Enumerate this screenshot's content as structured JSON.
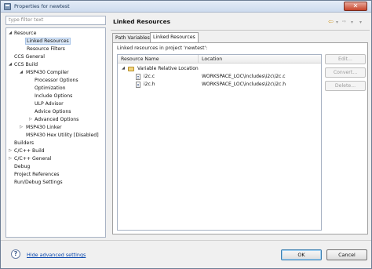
{
  "window": {
    "title": "Properties for newtest",
    "close_glyph": "✕"
  },
  "filter": {
    "placeholder": "type filter text"
  },
  "tree": [
    {
      "label": "Resource",
      "expanded": true
    },
    {
      "label": "Linked Resources",
      "selected": true
    },
    {
      "label": "Resource Filters"
    },
    {
      "label": "CCS General"
    },
    {
      "label": "CCS Build",
      "expanded": true
    },
    {
      "label": "MSP430 Compiler",
      "expanded": true
    },
    {
      "label": "Processor Options"
    },
    {
      "label": "Optimization"
    },
    {
      "label": "Include Options"
    },
    {
      "label": "ULP Advisor"
    },
    {
      "label": "Advice Options"
    },
    {
      "label": "Advanced Options",
      "collapsed": true
    },
    {
      "label": "MSP430 Linker",
      "collapsed": true
    },
    {
      "label": "MSP430 Hex Utility  [Disabled]"
    },
    {
      "label": "Builders"
    },
    {
      "label": "C/C++ Build",
      "collapsed": true
    },
    {
      "label": "C/C++ General",
      "collapsed": true
    },
    {
      "label": "Debug"
    },
    {
      "label": "Project References"
    },
    {
      "label": "Run/Debug Settings"
    }
  ],
  "page": {
    "title": "Linked Resources",
    "nav": {
      "back_icon": "back-arrow-icon",
      "forward_icon": "forward-arrow-icon",
      "menu_icon": "menu-down-icon"
    }
  },
  "tabs": [
    {
      "label": "Path Variables"
    },
    {
      "label": "Linked Resources",
      "active": true
    }
  ],
  "resources": {
    "caption": "Linked resources in project 'newtest':",
    "columns": [
      "Resource Name",
      "Location"
    ],
    "group": "Variable Relative Location",
    "rows": [
      {
        "name": "i2c.c",
        "location": "WORKSPACE_LOC\\includes\\i2c\\i2c.c"
      },
      {
        "name": "i2c.h",
        "location": "WORKSPACE_LOC\\includes\\i2c\\i2c.h"
      }
    ]
  },
  "side_buttons": {
    "edit": "Edit...",
    "convert": "Convert...",
    "delete": "Delete..."
  },
  "footer": {
    "help": "?",
    "advanced_link": "Hide advanced settings",
    "ok": "OK",
    "cancel": "Cancel"
  }
}
